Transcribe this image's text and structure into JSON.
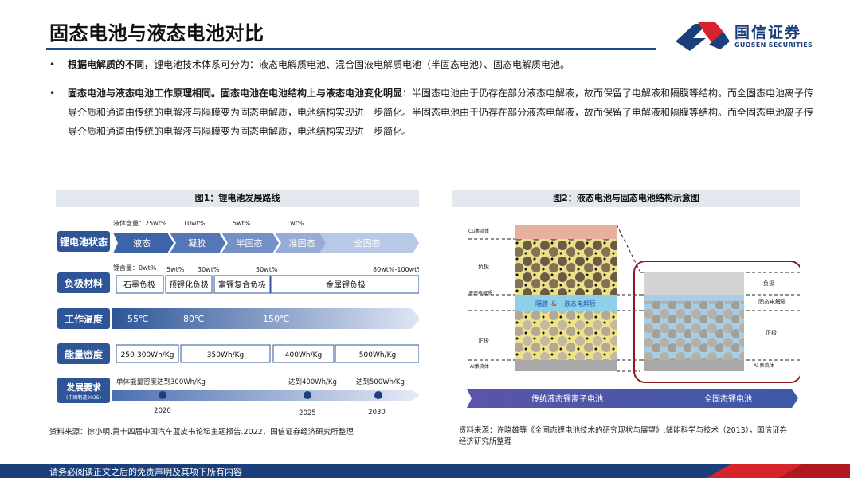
{
  "header": {
    "title": "固态电池与液态电池对比",
    "logo_cn": "国信证券",
    "logo_en": "GUOSEN SECURITIES",
    "brand_color": "#1b3f7a",
    "accent_color": "#d7232c"
  },
  "bullets": [
    {
      "bold": "根据电解质的不同，",
      "text": "锂电池技术体系可分为：液态电解质电池、混合固液电解质电池（半固态电池）、固态电解质电池。"
    },
    {
      "bold": "固态电池与液态电池工作原理相同。固态电池在电池结构上与液态电池变化明显",
      "text": "：半固态电池由于仍存在部分液态电解液，故而保留了电解液和隔膜等结构。而全固态电池离子传导介质和通道由传统的电解液与隔膜变为固态电解质，电池结构实现进一步简化。半固态电池由于仍存在部分液态电解液，故而保留了电解液和隔膜等结构。而全固态电池离子传导介质和通道由传统的电解液与隔膜变为固态电解质，电池结构实现进一步简化。"
    }
  ],
  "figure1": {
    "caption": "图1：锂电池发展路线",
    "rows": {
      "state": {
        "label": "锂电池状态",
        "top_labels": [
          "液体含量：25wt%",
          "10wt%",
          "5wt%",
          "1wt%"
        ],
        "stages": [
          "液态",
          "凝胶",
          "半固态",
          "准固态",
          "全固态"
        ]
      },
      "anode": {
        "label": "负极材料",
        "top_labels": [
          "锂含量：0wt%",
          "5wt%",
          "30wt%",
          "50wt%",
          "80wt%-100wt%"
        ],
        "boxes": [
          "石墨负极",
          "预锂化负极",
          "富锂复合负极",
          "金属锂负极"
        ]
      },
      "temp": {
        "label": "工作温度",
        "values": [
          "55℃",
          "80℃",
          "150℃"
        ]
      },
      "energy": {
        "label": "能量密度",
        "boxes": [
          "250-300Wh/Kg",
          "350Wh/Kg",
          "400Wh/Kg",
          "500Wh/Kg"
        ]
      },
      "goal": {
        "label": "发展要求",
        "sublabel": "(中国制造2025)",
        "notes": [
          "单体能量密度达到300Wh/Kg",
          "达到400Wh/Kg",
          "达到500Wh/Kg"
        ],
        "years": [
          "2020",
          "2025",
          "2030"
        ]
      }
    }
  },
  "figure2": {
    "caption": "图2：液态电池与固态电池结构示意图",
    "left_labels": [
      "Cu集流体",
      "负极",
      "液态电解质",
      "正极",
      "Al集流体"
    ],
    "middle_labels": [
      "隔膜",
      "&",
      "液态电解质"
    ],
    "right_labels": [
      "负极",
      "固态电解质",
      "正极",
      "Al 集流体"
    ],
    "bottom_labels": [
      "传统液态锂离子电池",
      "全固态锂电池"
    ]
  },
  "sources": {
    "fig1": "资料来源：徐小明.第十四届中国汽车蓝皮书论坛主题报告.2022，国信证券经济研究所整理",
    "fig2_line1": "资料来源：许晓雄等《全固态锂电池技术的研究现状与展望》.储能科学与技术（2013），国信证券",
    "fig2_line2": "经济研究所整理"
  },
  "footer": {
    "text": "请务必阅读正文之后的免责声明及其项下所有内容"
  }
}
